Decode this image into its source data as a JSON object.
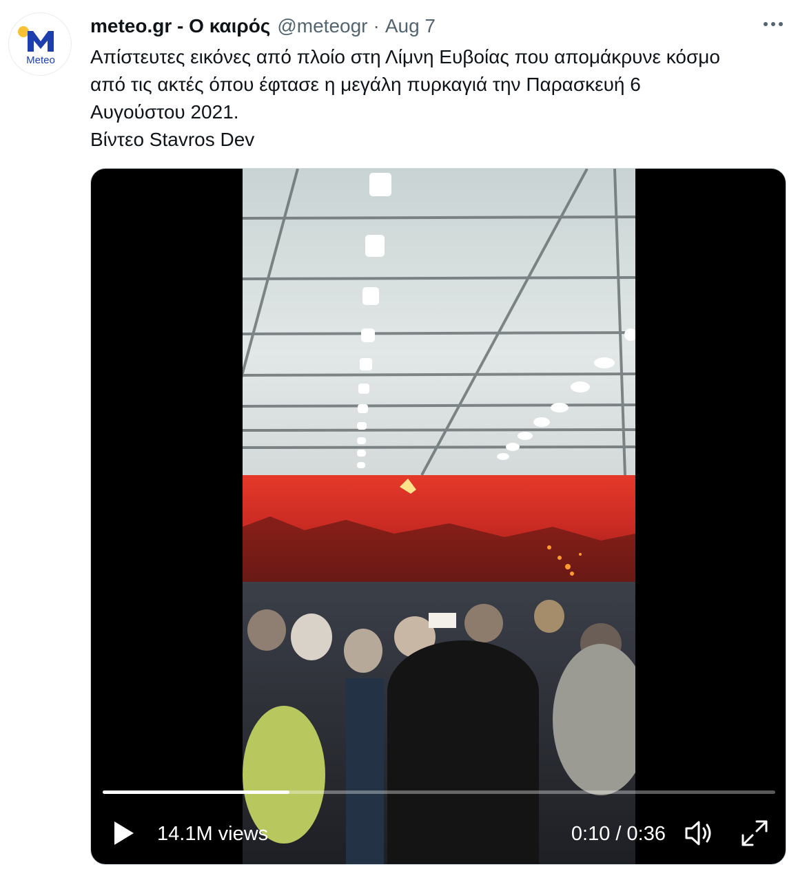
{
  "tweet": {
    "account_name": "meteo.gr - Ο καιρός",
    "handle": "@meteogr",
    "separator": "·",
    "date": "Aug 7",
    "text_lines": [
      "Απίστευτες εικόνες από πλοίο στη Λίμνη Ευβοίας που απομάκρυνε κόσμο",
      "από τις ακτές όπου έφτασε η μεγάλη πυρκαγιά την Παρασκευή 6",
      "Αυγούστου 2021.",
      "Βίντεο Stavros Dev"
    ]
  },
  "avatar": {
    "logo_text": "Meteo",
    "icon": "meteo-logo-icon",
    "colors": {
      "brand_blue": "#1d3fae",
      "sun_yellow": "#f6c234"
    }
  },
  "video": {
    "views": "14.1M views",
    "current_time": "0:10",
    "time_separator": " / ",
    "duration": "0:36",
    "progress": 0.278,
    "icons": [
      "play-icon",
      "volume-icon",
      "fullscreen-icon",
      "more-icon"
    ]
  }
}
